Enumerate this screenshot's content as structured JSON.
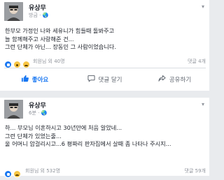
{
  "posts": [
    {
      "author": "유상무",
      "meta": "방금 · 🌏",
      "lines": [
        "한부모 가정인 나와 세유니가 힘들때 돌봐주고",
        "늘 함께해주고 사랑해준 건...",
        "그런 단체가 아닌... 장동민 그 사람이었습니다."
      ],
      "reaction_text": "회원님 외 40명",
      "comment_text": "댓글 4개",
      "reactions": [
        "like",
        "wow",
        "sad"
      ],
      "actions": {
        "like": "좋아요",
        "comment": "댓글 달기",
        "share": "공유하기"
      }
    },
    {
      "author": "유상무",
      "meta": "6분 · 🌏",
      "lines": [
        "하... 부모님 이혼하시고 30년만에 처음 알았네...",
        "그런 단체가 있었는줄...",
        "울 어머니 암걸리시고...6 평짜리 판자집에서 살때 좀 나타나 주시지..."
      ],
      "reaction_text": "회원님 외 532명",
      "comment_text": "댓글 59개",
      "reactions": [
        "like",
        "sad"
      ]
    }
  ],
  "icons": {
    "menu": "chevron-down-icon",
    "privacy": "globe-icon",
    "like": "thumbs-up-icon",
    "comment": "speech-bubble-icon",
    "share": "share-arrow-icon"
  },
  "colors": {
    "accent": "#1877f2",
    "secondary_text": "#90949c",
    "background": "#e9ebee"
  }
}
